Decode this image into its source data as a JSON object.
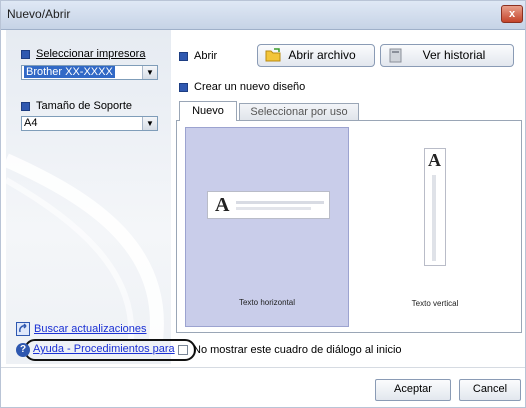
{
  "window": {
    "title": "Nuevo/Abrir",
    "close_label": "x"
  },
  "left": {
    "printer_label": "Seleccionar impresora",
    "printer_value": "Brother XX-XXXX",
    "media_label": "Tamaño de Soporte",
    "media_value": "A4",
    "update_link": "Buscar actualizaciones",
    "help_link": "Ayuda - Procedimientos para"
  },
  "right": {
    "open_label": "Abrir",
    "open_file_button": "Abrir archivo",
    "history_button": "Ver historial",
    "create_label": "Crear un nuevo diseño",
    "tabs": [
      {
        "label": "Nuevo",
        "active": true
      },
      {
        "label": "Seleccionar por uso",
        "active": false
      }
    ],
    "cards": [
      {
        "caption": "Texto horizontal",
        "selected": true,
        "glyph": "A"
      },
      {
        "caption": "Texto vertical",
        "selected": false,
        "glyph": "A"
      }
    ],
    "no_show_label": "No mostrar este cuadro de diálogo al inicio"
  },
  "footer": {
    "accept_button": "Aceptar",
    "cancel_button": "Cancel"
  },
  "colors": {
    "accent": "#2f58b0",
    "selection": "#c9cdea",
    "link": "#1a2fd4"
  }
}
